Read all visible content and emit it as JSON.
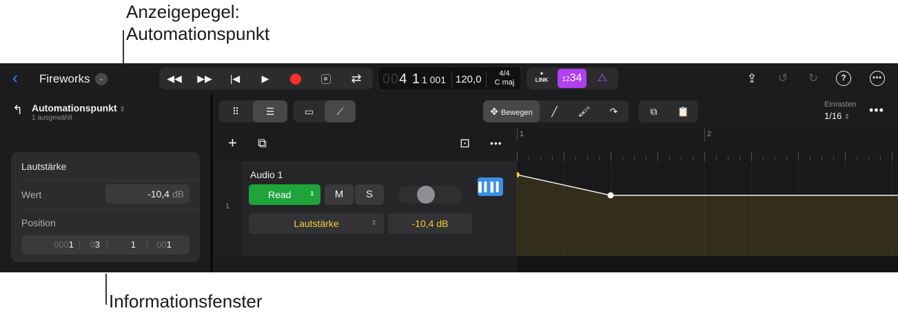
{
  "callouts": {
    "top_line1": "Anzeigepegel:",
    "top_line2": "Automationspunkt",
    "bottom": "Informationsfenster"
  },
  "topbar": {
    "back_icon": "chevron-left-icon",
    "project_title": "Fireworks",
    "project_menu_icon": "chevron-down-icon",
    "transport": {
      "rewind_icon": "rewind-icon",
      "forward_icon": "fast-forward-icon",
      "to_start_icon": "go-to-start-icon",
      "play_icon": "play-icon",
      "record_icon": "record-icon",
      "capture_icon": "capture-record-icon",
      "cycle_icon": "cycle-icon"
    },
    "lcd": {
      "position_dim": "00",
      "position_main": "4 1",
      "position_sub": "1 001",
      "tempo": "120,0",
      "signature": "4/4",
      "key": "C maj"
    },
    "tools": {
      "link_label": "LINK",
      "count_in_small": "12",
      "count_in_main": "34",
      "metronome_icon": "metronome-icon"
    },
    "right": {
      "share_icon": "share-icon",
      "undo_icon": "undo-icon",
      "redo_icon": "redo-icon",
      "help_label": "?",
      "more_icon": "more-icon"
    }
  },
  "inspector": {
    "back_icon": "return-up-icon",
    "title": "Automationspunkt",
    "subtitle": "1 ausgewählt",
    "section_title": "Lautstärke",
    "value_label": "Wert",
    "value": "-10,4",
    "value_unit": "dB",
    "position_label": "Position",
    "position": [
      {
        "dim": "000",
        "main": "1"
      },
      {
        "dim": "0",
        "main": "3"
      },
      {
        "dim": "",
        "main": "1"
      },
      {
        "dim": "00",
        "main": "1"
      }
    ]
  },
  "editor": {
    "toolbar": {
      "grid_icon": "grid-icon",
      "tracks_icon": "tracks-view-icon",
      "region_icon": "region-icon",
      "automation_icon": "automation-curve-icon",
      "move_icon": "move-icon",
      "move_label": "Bewegen",
      "pencil_icon": "pencil-icon",
      "brush_icon": "brush-icon",
      "curve_icon": "curve-icon",
      "copy_icon": "copy-icon",
      "paste_icon": "paste-icon",
      "snap_label": "Einrasten",
      "snap_value": "1/16",
      "more_icon": "more-icon"
    },
    "track_header_bar": {
      "add_icon": "plus-icon",
      "duplicate_icon": "duplicate-track-icon",
      "import_icon": "import-icon",
      "more_icon": "more-icon"
    },
    "track": {
      "number": "1",
      "name": "Audio 1",
      "mode": "Read",
      "mute": "M",
      "solo": "S",
      "wave_icon": "waveform-icon",
      "parameter": "Lautstärke",
      "parameter_value": "-10,4 dB"
    },
    "ruler": {
      "bars": [
        "1",
        "2"
      ]
    },
    "automation": {
      "color": "#f4cf3a",
      "points": [
        {
          "bar": 1.0,
          "db": -4.2
        },
        {
          "bar": 1.5,
          "db": -10.4
        },
        {
          "bar": 3.0,
          "db": -10.4
        }
      ]
    }
  }
}
